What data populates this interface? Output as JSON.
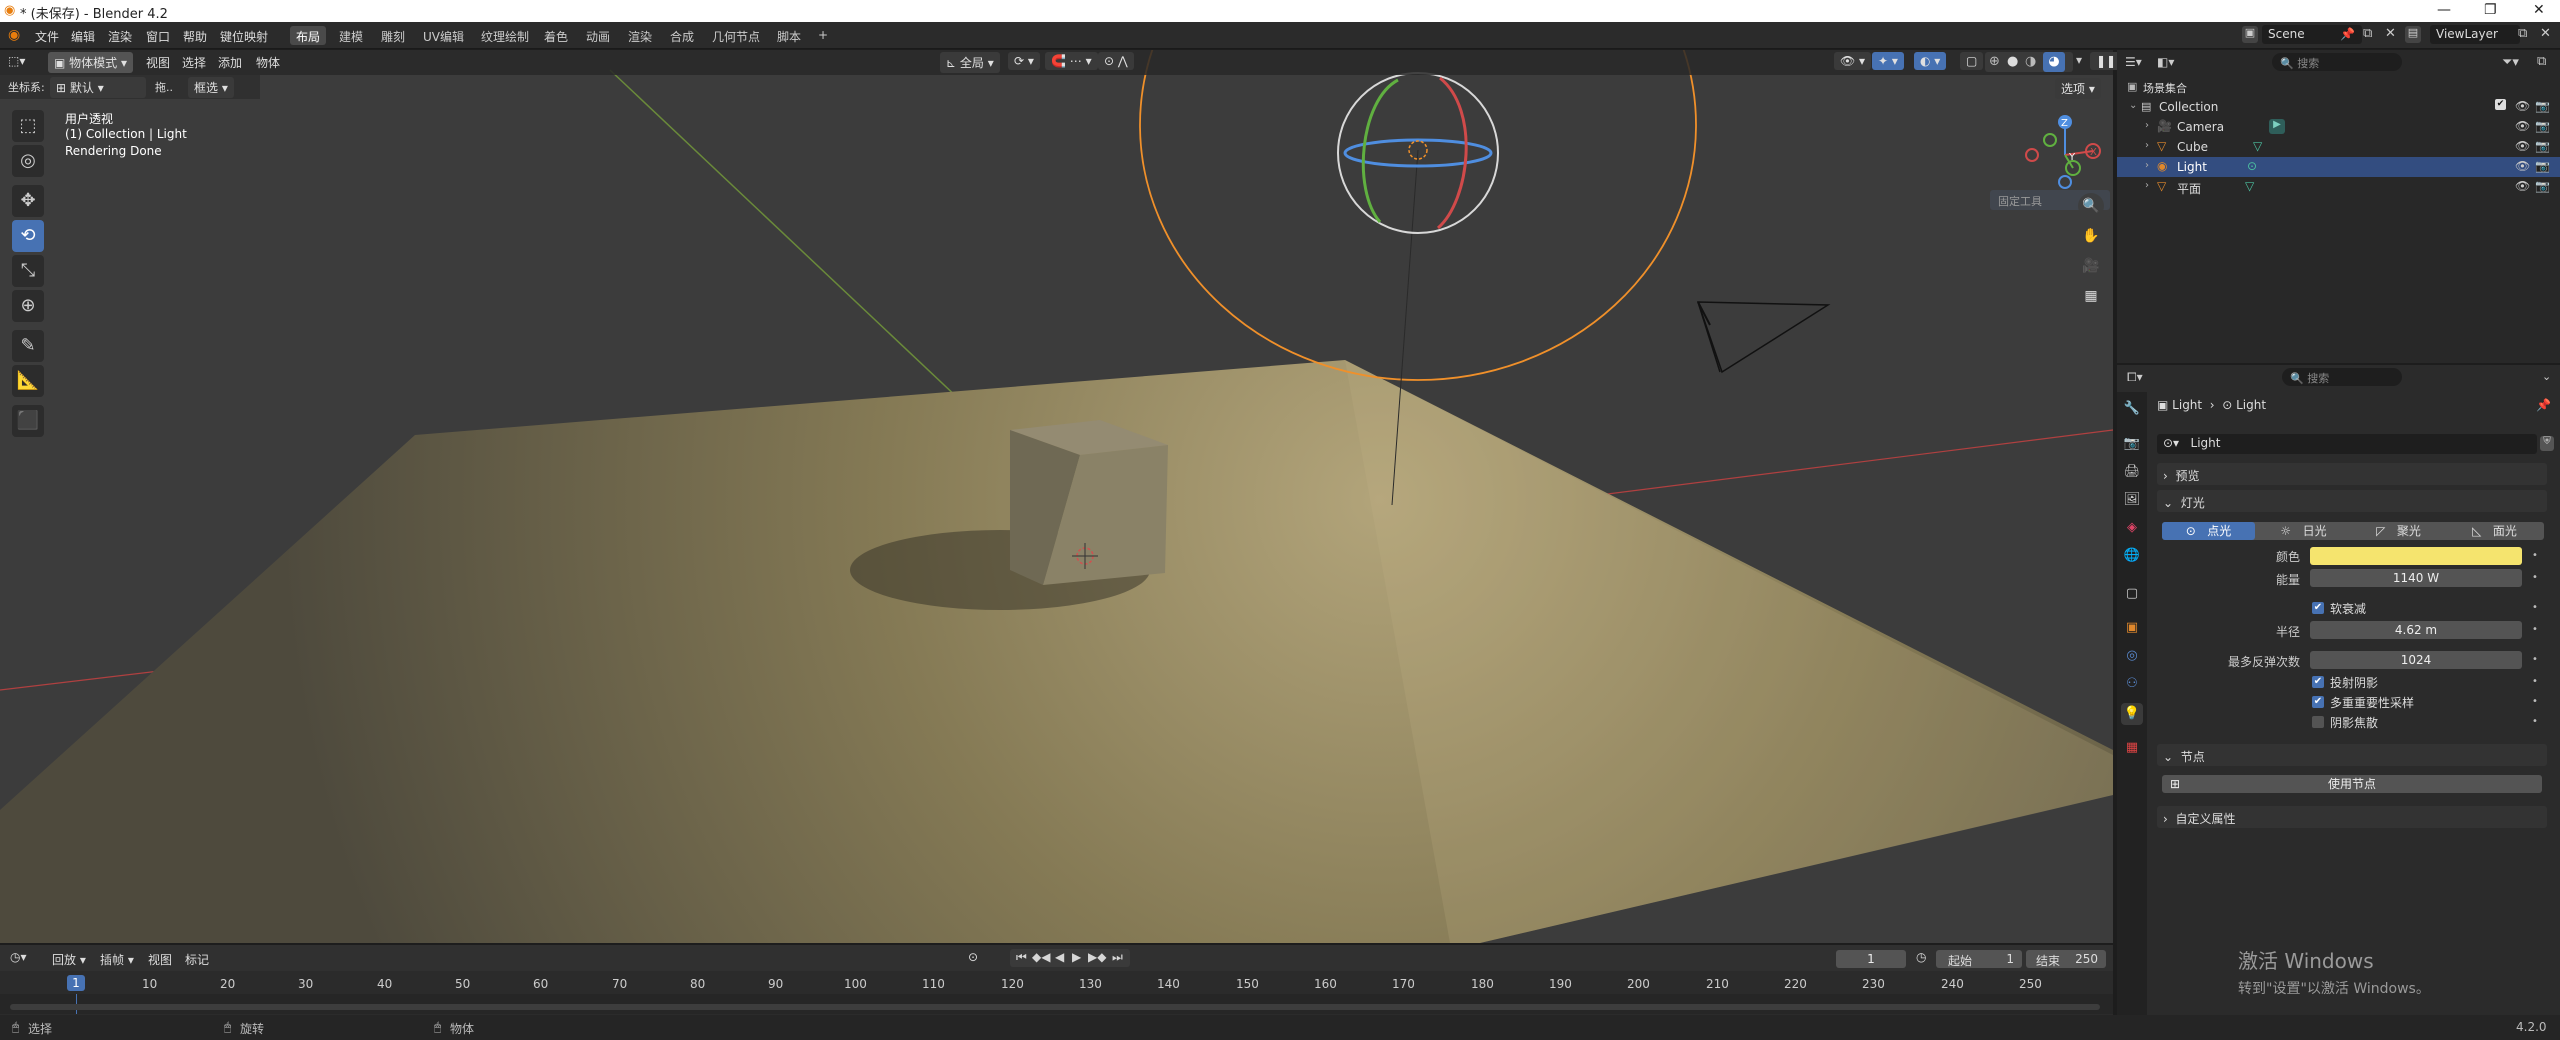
{
  "window": {
    "title": "* (未保存) - Blender 4.2"
  },
  "menu": [
    "文件",
    "编辑",
    "渲染",
    "窗口",
    "帮助",
    "键位映射"
  ],
  "workspaces": [
    {
      "label": "布局",
      "active": true
    },
    {
      "label": "建模"
    },
    {
      "label": "雕刻"
    },
    {
      "label": "UV编辑"
    },
    {
      "label": "纹理绘制"
    },
    {
      "label": "着色"
    },
    {
      "label": "动画"
    },
    {
      "label": "渲染"
    },
    {
      "label": "合成"
    },
    {
      "label": "几何节点"
    },
    {
      "label": "脚本"
    },
    {
      "label": "+"
    }
  ],
  "scene": {
    "name": "Scene",
    "view_layer": "ViewLayer"
  },
  "viewport": {
    "mode": "物体模式",
    "menus": [
      "视图",
      "选择",
      "添加",
      "物体"
    ],
    "orientation_label": "坐标系:",
    "orientation": "默认",
    "drag_label": "拖..",
    "select_mode": "框选",
    "transform_orient": "全局",
    "options": "选项",
    "info": [
      "用户透视",
      "(1) Collection | Light",
      "Rendering Done"
    ],
    "gizmo_axes": [
      "Z",
      "Y",
      "X"
    ],
    "tooltip": "固定工具"
  },
  "outliner": {
    "search_placeholder": "搜索",
    "root": "场景集合",
    "collection": "Collection",
    "items": [
      {
        "name": "Camera",
        "icon": "camera-icon"
      },
      {
        "name": "Cube",
        "icon": "mesh-icon"
      },
      {
        "name": "Light",
        "icon": "light-icon",
        "selected": true
      },
      {
        "name": "平面",
        "icon": "mesh-icon"
      }
    ]
  },
  "properties": {
    "search_placeholder": "搜索",
    "breadcrumb": [
      "Light",
      "Light"
    ],
    "datablock": "Light",
    "panels": {
      "preview": "预览",
      "light": "灯光",
      "nodes": "节点",
      "custom": "自定义属性"
    },
    "light_types": [
      "点光",
      "日光",
      "聚光",
      "面光"
    ],
    "active_type": "点光",
    "color_label": "颜色",
    "color": "#f5e46e",
    "power_label": "能量",
    "power": "1140 W",
    "soft_falloff": "软衰减",
    "radius_label": "半径",
    "radius": "4.62 m",
    "bounces_label": "最多反弹次数",
    "bounces": "1024",
    "cast_shadow": "投射阴影",
    "multi_importance": "多重重要性采样",
    "shadow_caustics": "阴影焦散",
    "use_nodes": "使用节点"
  },
  "timeline": {
    "menus": [
      "回放",
      "插帧",
      "视图",
      "标记"
    ],
    "current_frame": "1",
    "start_label": "起始",
    "start": "1",
    "end_label": "结束",
    "end": "250",
    "ticks": [
      "1",
      "10",
      "20",
      "30",
      "40",
      "50",
      "60",
      "70",
      "80",
      "90",
      "100",
      "110",
      "120",
      "130",
      "140",
      "150",
      "160",
      "170",
      "180",
      "190",
      "200",
      "210",
      "220",
      "230",
      "240",
      "250"
    ]
  },
  "status": {
    "select": "选择",
    "rotate": "旋转",
    "object": "物体",
    "version": "4.2.0"
  },
  "watermark": {
    "line1": "激活 Windows",
    "line2": "转到\"设置\"以激活 Windows。"
  }
}
